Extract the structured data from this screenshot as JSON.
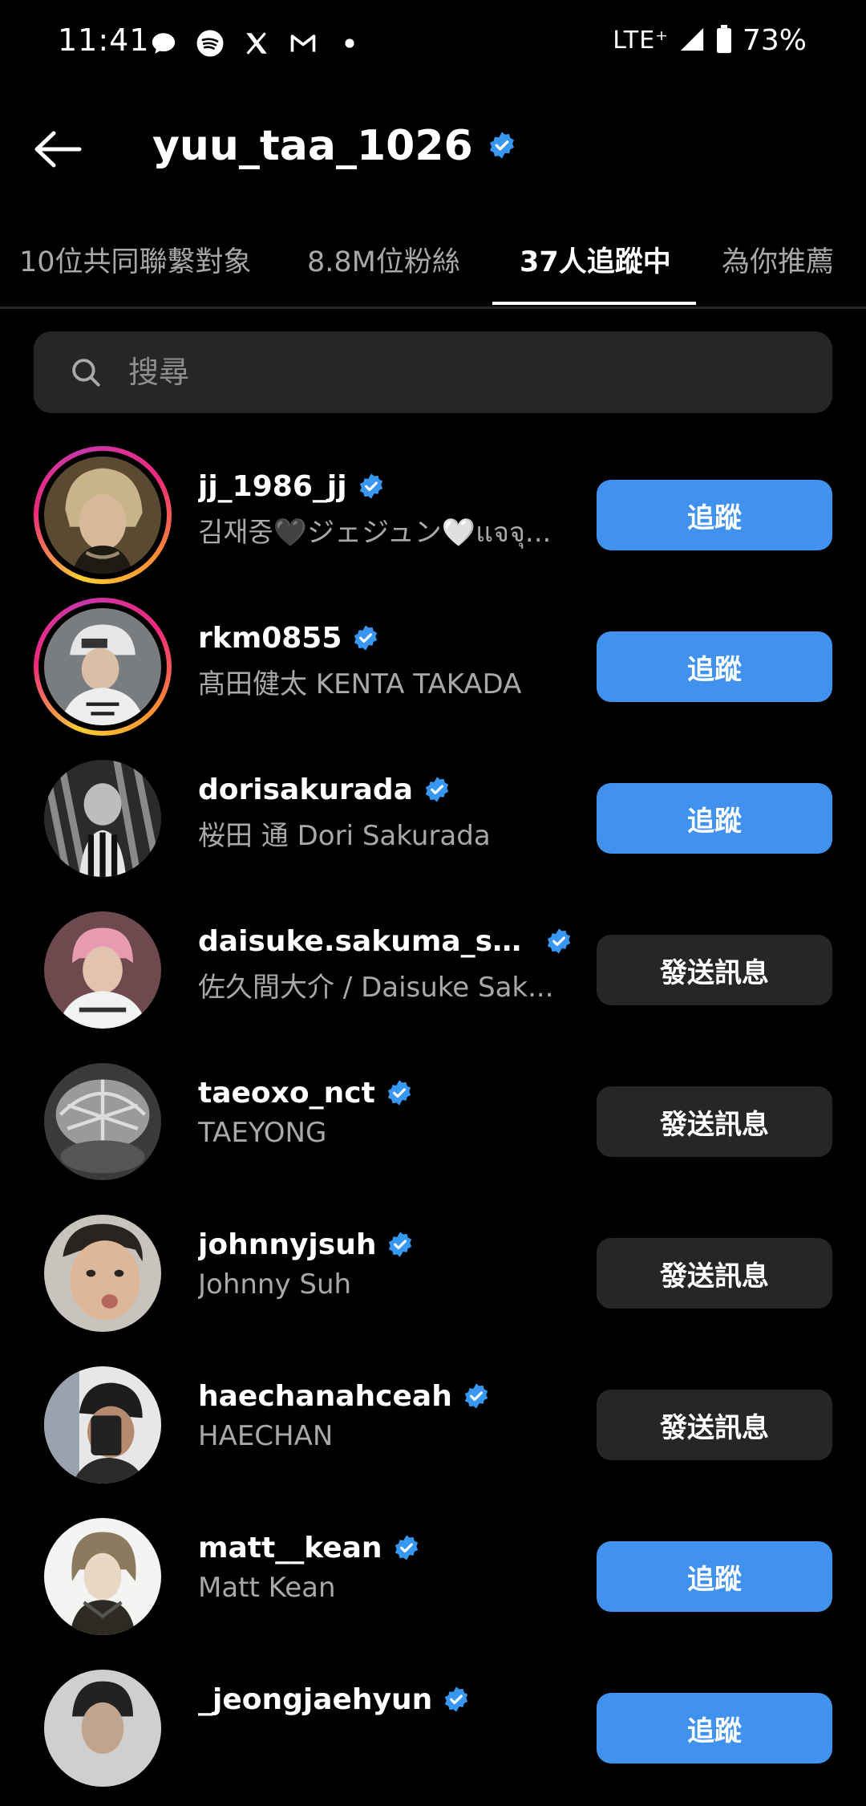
{
  "status_bar": {
    "time": "11:41",
    "network": "LTE⁺",
    "battery": "73%"
  },
  "header": {
    "title": "yuu_taa_1026"
  },
  "tabs": [
    {
      "label": "10位共同聯繫對象",
      "active": false
    },
    {
      "label": "8.8M位粉絲",
      "active": false
    },
    {
      "label": "37人追蹤中",
      "active": true
    },
    {
      "label": "為你推薦",
      "active": false
    }
  ],
  "search": {
    "placeholder": "搜尋"
  },
  "users": [
    {
      "username": "jj_1986_jj",
      "full_name": "김재중🖤ジェジュン🤍แจจุ...",
      "button": "追蹤",
      "story": true
    },
    {
      "username": "rkm0855",
      "full_name": "髙田健太 KENTA TAKADA",
      "button": "追蹤",
      "story": true
    },
    {
      "username": "dorisakurada",
      "full_name": "桜田 通 Dori Sakurada",
      "button": "追蹤",
      "story": false
    },
    {
      "username": "daisuke.sakuma_sn_o...",
      "full_name": "佐久間大介 / Daisuke Sak...",
      "button": "發送訊息",
      "story": false
    },
    {
      "username": "taeoxo_nct",
      "full_name": "TAEYONG",
      "button": "發送訊息",
      "story": false
    },
    {
      "username": "johnnyjsuh",
      "full_name": "Johnny Suh",
      "button": "發送訊息",
      "story": false
    },
    {
      "username": "haechanahceah",
      "full_name": "HAECHAN",
      "button": "發送訊息",
      "story": false
    },
    {
      "username": "matt__kean",
      "full_name": "Matt Kean",
      "button": "追蹤",
      "story": false
    },
    {
      "username": "_jeongjaehyun",
      "full_name": "",
      "button": "追蹤",
      "story": false
    }
  ],
  "colors": {
    "background": "#000000",
    "follow_button": "#4192ef",
    "message_button": "#262626",
    "verified": "#3897f0",
    "secondary_text": "#a8a8a8"
  }
}
